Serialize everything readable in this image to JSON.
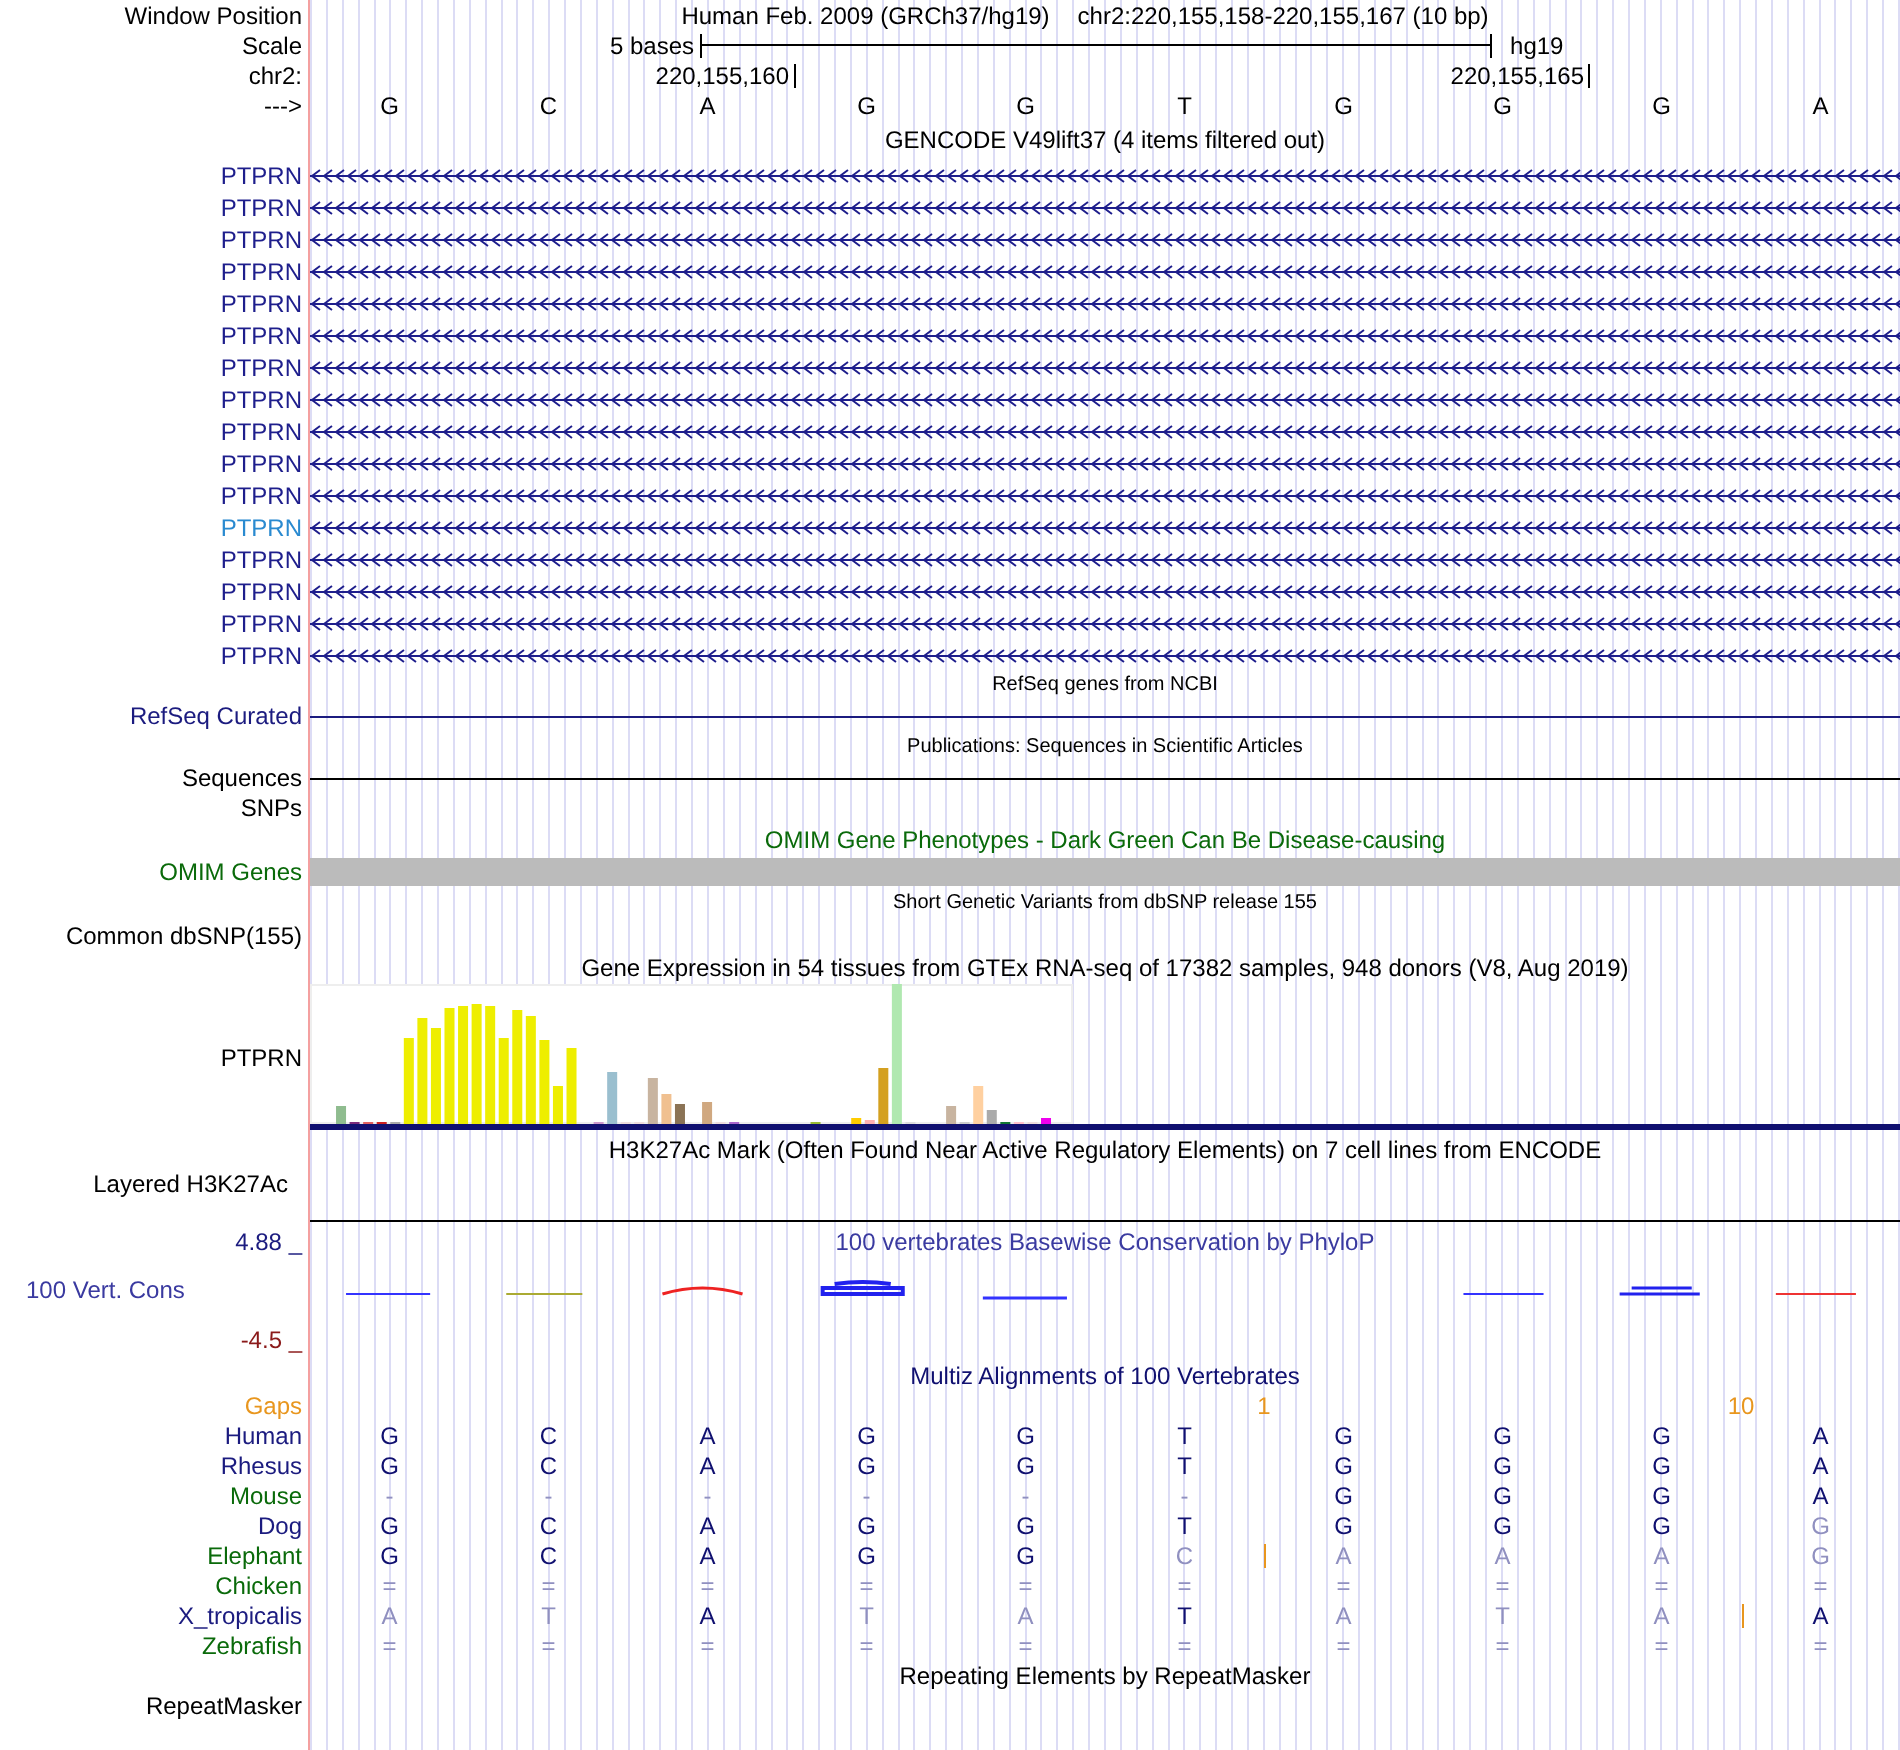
{
  "header": {
    "window_position_label": "Window Position",
    "assembly": "Human Feb. 2009 (GRCh37/hg19)",
    "position": "chr2:220,155,158-220,155,167 (10 bp)",
    "scale_label": "Scale",
    "scale_text": "5 bases",
    "scale_db": "hg19",
    "chrom_label": "chr2:",
    "ticks": [
      "220,155,160",
      "220,155,165"
    ],
    "strand_label": "--->",
    "bases": [
      "G",
      "C",
      "A",
      "G",
      "G",
      "T",
      "G",
      "G",
      "G",
      "A"
    ]
  },
  "gencode": {
    "title": "GENCODE V49lift37 (4 items filtered out)",
    "genes": [
      {
        "label": "PTPRN",
        "color": "#1e1e8c"
      },
      {
        "label": "PTPRN",
        "color": "#1e1e8c"
      },
      {
        "label": "PTPRN",
        "color": "#1e1e8c"
      },
      {
        "label": "PTPRN",
        "color": "#1e1e8c"
      },
      {
        "label": "PTPRN",
        "color": "#1e1e8c"
      },
      {
        "label": "PTPRN",
        "color": "#1e1e8c"
      },
      {
        "label": "PTPRN",
        "color": "#1e1e8c"
      },
      {
        "label": "PTPRN",
        "color": "#1e1e8c"
      },
      {
        "label": "PTPRN",
        "color": "#1e1e8c"
      },
      {
        "label": "PTPRN",
        "color": "#1e1e8c"
      },
      {
        "label": "PTPRN",
        "color": "#1e1e8c"
      },
      {
        "label": "PTPRN",
        "color": "#2a8ad0"
      },
      {
        "label": "PTPRN",
        "color": "#1e1e8c"
      },
      {
        "label": "PTPRN",
        "color": "#1e1e8c"
      },
      {
        "label": "PTPRN",
        "color": "#1e1e8c"
      },
      {
        "label": "PTPRN",
        "color": "#1e1e8c"
      }
    ]
  },
  "refseq": {
    "title": "RefSeq genes from NCBI",
    "label": "RefSeq Curated"
  },
  "publications": {
    "title": "Publications: Sequences in Scientific Articles",
    "label": "Sequences"
  },
  "snps": {
    "label": "SNPs"
  },
  "omim": {
    "title": "OMIM Gene Phenotypes - Dark Green Can Be Disease-causing",
    "label": "OMIM Genes"
  },
  "dbsnp": {
    "title": "Short Genetic Variants from dbSNP release 155",
    "label": "Common dbSNP(155)"
  },
  "gtex": {
    "title": "Gene Expression in 54 tissues from GTEx RNA-seq of 17382 samples, 948 donors (V8, Aug 2019)",
    "label": "PTPRN"
  },
  "h3k27ac": {
    "title": "H3K27Ac Mark (Often Found Near Active Regulatory Elements) on 7 cell lines from ENCODE",
    "label": "Layered H3K27Ac"
  },
  "phylop": {
    "title": "100 vertebrates Basewise Conservation by PhyloP",
    "label": "100 Vert. Cons",
    "ymax": "4.88 _",
    "ymin": "-4.5 _"
  },
  "multiz": {
    "title": "Multiz Alignments of 100 Vertebrates",
    "gaps_label": "Gaps",
    "gap_numbers": [
      "1",
      "10"
    ],
    "species": [
      {
        "name": "Human",
        "color": "#1b1b7f",
        "bases": [
          {
            "kind": "base",
            "base": "G",
            "faint": false
          },
          {
            "kind": "base",
            "base": "C",
            "faint": false
          },
          {
            "kind": "base",
            "base": "A",
            "faint": false
          },
          {
            "kind": "base",
            "base": "G",
            "faint": false
          },
          {
            "kind": "base",
            "base": "G",
            "faint": false
          },
          {
            "kind": "base",
            "base": "T",
            "faint": false
          },
          {
            "kind": "base",
            "base": "G",
            "faint": false
          },
          {
            "kind": "base",
            "base": "G",
            "faint": false
          },
          {
            "kind": "base",
            "base": "G",
            "faint": false
          },
          {
            "kind": "base",
            "base": "A",
            "faint": false
          }
        ]
      },
      {
        "name": "Rhesus",
        "color": "#1b1b7f",
        "bases": [
          {
            "kind": "base",
            "base": "G",
            "faint": false
          },
          {
            "kind": "base",
            "base": "C",
            "faint": false
          },
          {
            "kind": "base",
            "base": "A",
            "faint": false
          },
          {
            "kind": "base",
            "base": "G",
            "faint": false
          },
          {
            "kind": "base",
            "base": "G",
            "faint": false
          },
          {
            "kind": "base",
            "base": "T",
            "faint": false
          },
          {
            "kind": "base",
            "base": "G",
            "faint": false
          },
          {
            "kind": "base",
            "base": "G",
            "faint": false
          },
          {
            "kind": "base",
            "base": "G",
            "faint": false
          },
          {
            "kind": "base",
            "base": "A",
            "faint": false
          }
        ]
      },
      {
        "name": "Mouse",
        "color": "#0a6a0a",
        "bases": [
          {
            "kind": "base",
            "base": "-",
            "faint": true
          },
          {
            "kind": "base",
            "base": "-",
            "faint": true
          },
          {
            "kind": "base",
            "base": "-",
            "faint": true
          },
          {
            "kind": "base",
            "base": "-",
            "faint": true
          },
          {
            "kind": "base",
            "base": "-",
            "faint": true
          },
          {
            "kind": "base",
            "base": "-",
            "faint": true
          },
          {
            "kind": "base",
            "base": "G",
            "faint": false
          },
          {
            "kind": "base",
            "base": "G",
            "faint": false
          },
          {
            "kind": "base",
            "base": "G",
            "faint": false
          },
          {
            "kind": "base",
            "base": "A",
            "faint": false
          }
        ]
      },
      {
        "name": "Dog",
        "color": "#1b1b7f",
        "bases": [
          {
            "kind": "base",
            "base": "G",
            "faint": false
          },
          {
            "kind": "base",
            "base": "C",
            "faint": false
          },
          {
            "kind": "base",
            "base": "A",
            "faint": false
          },
          {
            "kind": "base",
            "base": "G",
            "faint": false
          },
          {
            "kind": "base",
            "base": "G",
            "faint": false
          },
          {
            "kind": "base",
            "base": "T",
            "faint": false
          },
          {
            "kind": "base",
            "base": "G",
            "faint": false
          },
          {
            "kind": "base",
            "base": "G",
            "faint": false
          },
          {
            "kind": "base",
            "base": "G",
            "faint": false
          },
          {
            "kind": "base",
            "base": "G",
            "faint": true
          }
        ]
      },
      {
        "name": "Elephant",
        "color": "#0a6a0a",
        "bases": [
          {
            "kind": "base",
            "base": "G",
            "faint": false
          },
          {
            "kind": "base",
            "base": "C",
            "faint": false
          },
          {
            "kind": "base",
            "base": "A",
            "faint": false
          },
          {
            "kind": "base",
            "base": "G",
            "faint": false
          },
          {
            "kind": "base",
            "base": "G",
            "faint": false
          },
          {
            "kind": "base",
            "base": "C",
            "faint": true
          },
          {
            "kind": "insert"
          },
          {
            "kind": "base",
            "base": "A",
            "faint": true
          },
          {
            "kind": "base",
            "base": "A",
            "faint": true
          },
          {
            "kind": "base",
            "base": "A",
            "faint": true
          },
          {
            "kind": "base",
            "base": "G",
            "faint": true
          }
        ]
      },
      {
        "name": "Chicken",
        "color": "#0a6a0a",
        "bases": [
          {
            "kind": "base",
            "base": "=",
            "faint": true
          },
          {
            "kind": "base",
            "base": "=",
            "faint": true
          },
          {
            "kind": "base",
            "base": "=",
            "faint": true
          },
          {
            "kind": "base",
            "base": "=",
            "faint": true
          },
          {
            "kind": "base",
            "base": "=",
            "faint": true
          },
          {
            "kind": "base",
            "base": "=",
            "faint": true
          },
          {
            "kind": "base",
            "base": "=",
            "faint": true
          },
          {
            "kind": "base",
            "base": "=",
            "faint": true
          },
          {
            "kind": "base",
            "base": "=",
            "faint": true
          },
          {
            "kind": "base",
            "base": "=",
            "faint": true
          }
        ]
      },
      {
        "name": "X_tropicalis",
        "color": "#1b1b7f",
        "bases": [
          {
            "kind": "base",
            "base": "A",
            "faint": true
          },
          {
            "kind": "base",
            "base": "T",
            "faint": true
          },
          {
            "kind": "base",
            "base": "A",
            "faint": false
          },
          {
            "kind": "base",
            "base": "T",
            "faint": true
          },
          {
            "kind": "base",
            "base": "A",
            "faint": true
          },
          {
            "kind": "base",
            "base": "T",
            "faint": false
          },
          {
            "kind": "base",
            "base": "A",
            "faint": true
          },
          {
            "kind": "base",
            "base": "T",
            "faint": true
          },
          {
            "kind": "base",
            "base": "A",
            "faint": true
          },
          {
            "kind": "insert"
          },
          {
            "kind": "base",
            "base": "A",
            "faint": false
          }
        ]
      },
      {
        "name": "Zebrafish",
        "color": "#0a6a0a",
        "bases": [
          {
            "kind": "base",
            "base": "=",
            "faint": true
          },
          {
            "kind": "base",
            "base": "=",
            "faint": true
          },
          {
            "kind": "base",
            "base": "=",
            "faint": true
          },
          {
            "kind": "base",
            "base": "=",
            "faint": true
          },
          {
            "kind": "base",
            "base": "=",
            "faint": true
          },
          {
            "kind": "base",
            "base": "=",
            "faint": true
          },
          {
            "kind": "base",
            "base": "=",
            "faint": true
          },
          {
            "kind": "base",
            "base": "=",
            "faint": true
          },
          {
            "kind": "base",
            "base": "=",
            "faint": true
          },
          {
            "kind": "base",
            "base": "=",
            "faint": true
          }
        ]
      }
    ]
  },
  "repeatmasker": {
    "title": "Repeating Elements by RepeatMasker",
    "label": "RepeatMasker"
  }
}
